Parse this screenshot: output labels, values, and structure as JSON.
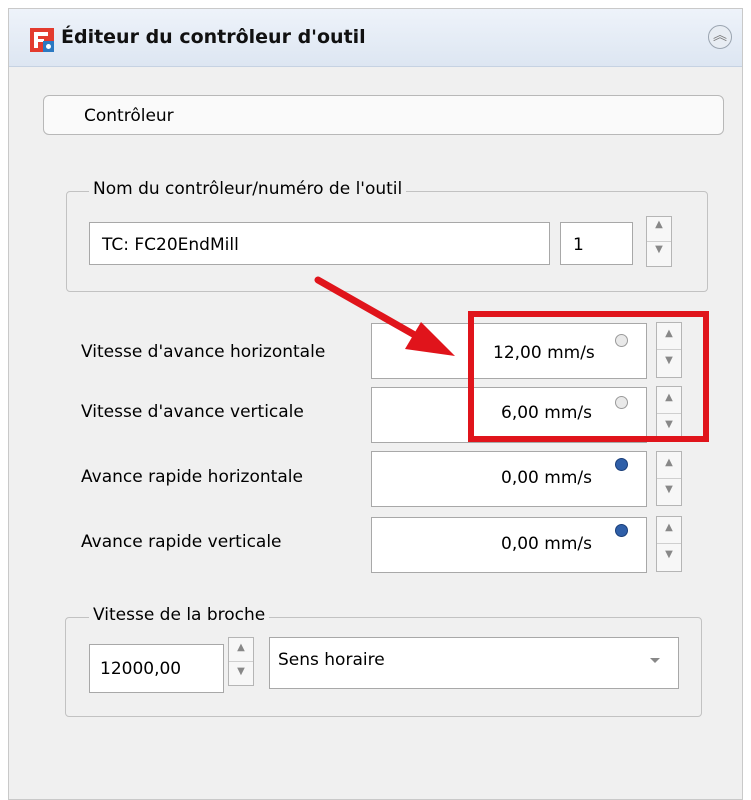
{
  "panel": {
    "title": "Éditeur du contrôleur d'outil",
    "section_label": "Contrôleur"
  },
  "controller_group": {
    "legend": "Nom du contrôleur/numéro de l'outil",
    "name_value": "TC: FC20EndMill",
    "tool_number": "1"
  },
  "feeds": [
    {
      "label": "Vitesse d'avance horizontale",
      "value": "12,00 mm/s",
      "expression_active": false
    },
    {
      "label": "Vitesse d'avance verticale",
      "value": "6,00 mm/s",
      "expression_active": false
    },
    {
      "label": "Avance rapide horizontale",
      "value": "0,00 mm/s",
      "expression_active": true
    },
    {
      "label": "Avance rapide verticale",
      "value": "0,00 mm/s",
      "expression_active": true
    }
  ],
  "spindle_group": {
    "legend": "Vitesse de la broche",
    "speed_value": "12000,00",
    "direction_value": "Sens horaire"
  },
  "colors": {
    "annotation_red": "#e0141b",
    "accent_blue": "#2f5fa8"
  }
}
